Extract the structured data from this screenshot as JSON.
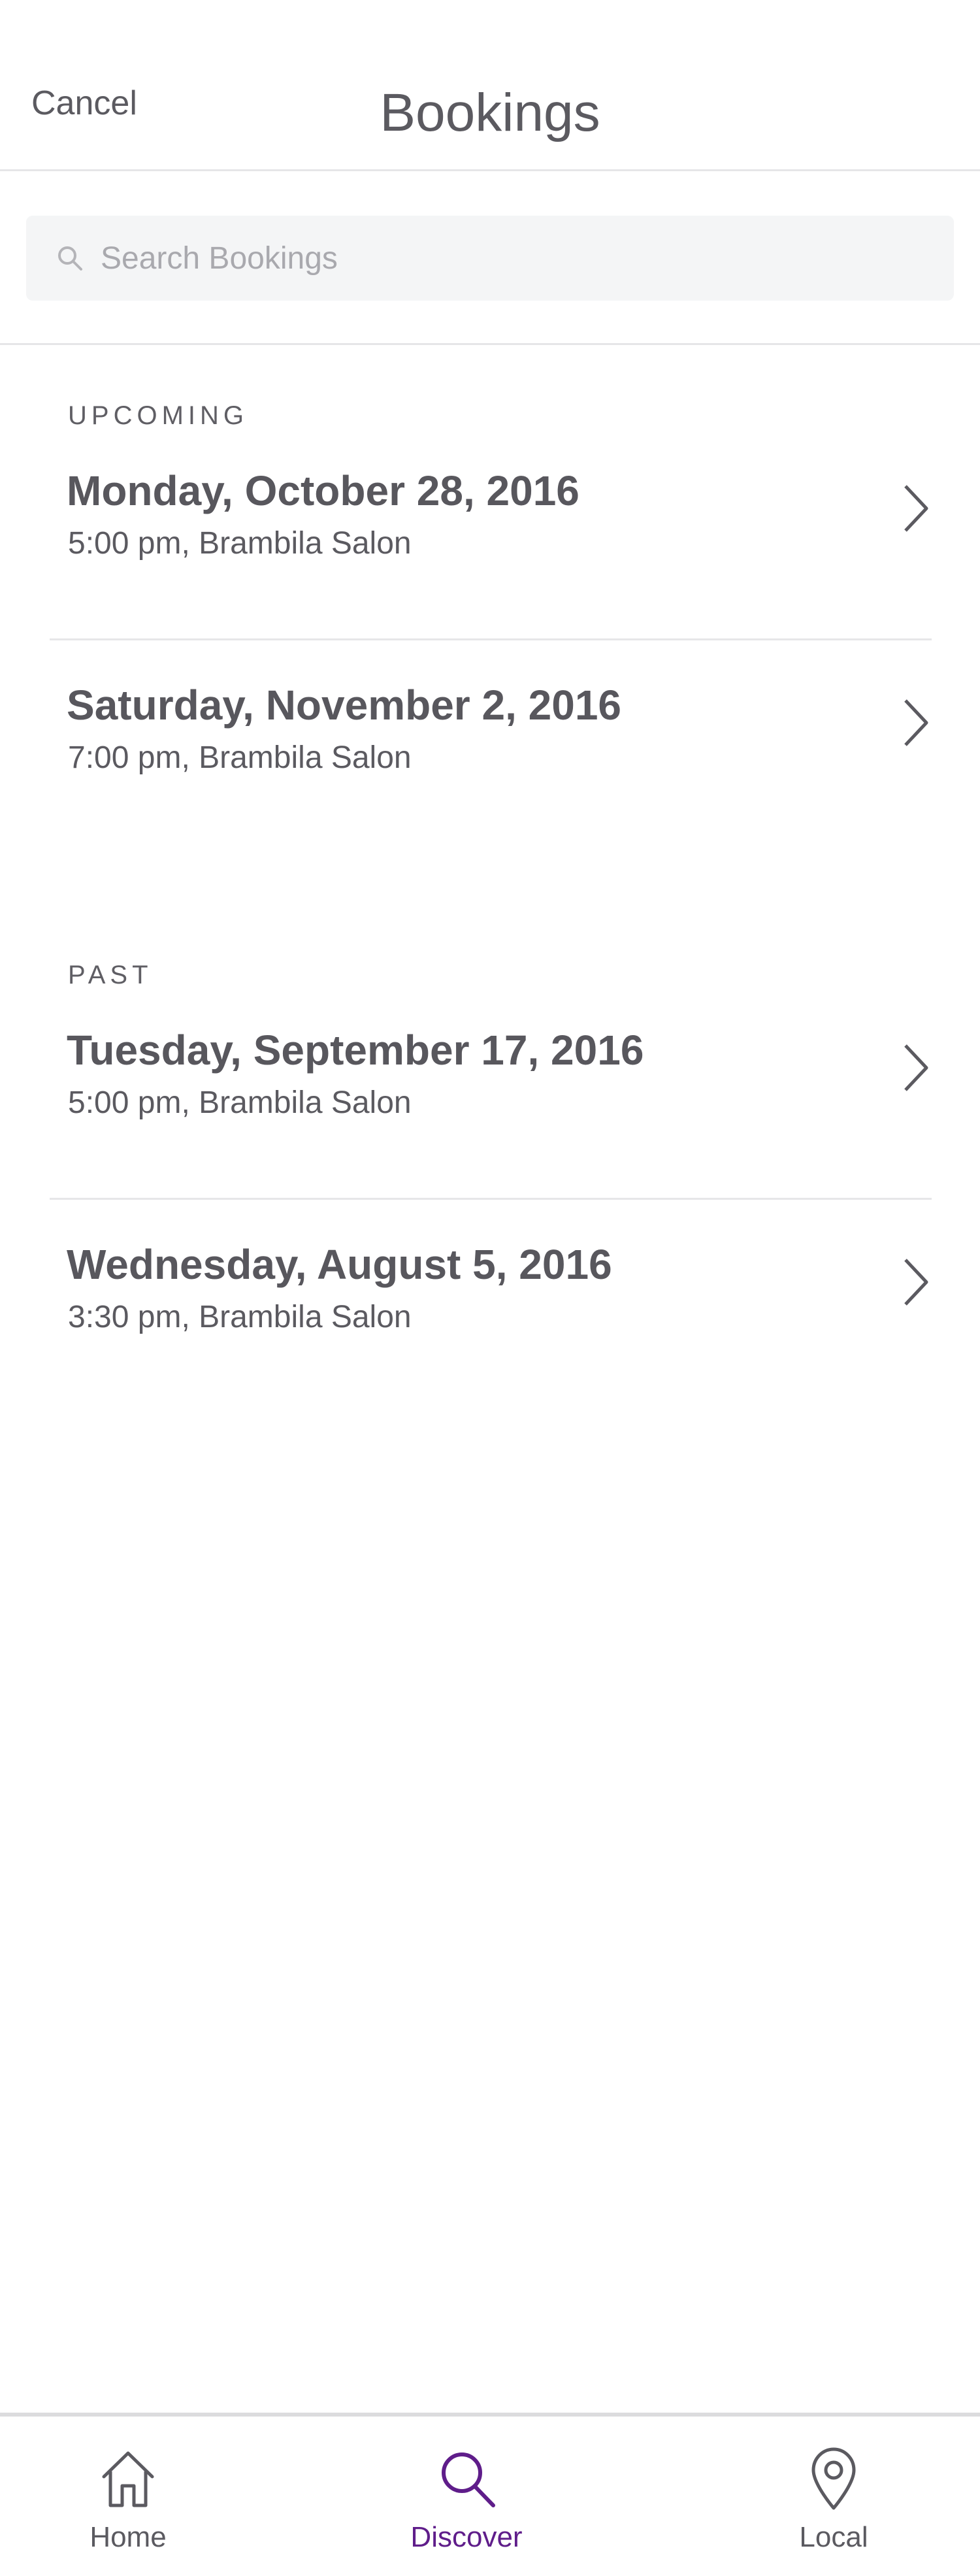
{
  "header": {
    "cancel_label": "Cancel",
    "title": "Bookings"
  },
  "search": {
    "placeholder": "Search Bookings",
    "value": ""
  },
  "sections": {
    "upcoming": {
      "label": "UPCOMING",
      "bookings": [
        {
          "date": "Monday, October 28, 2016",
          "detail": "5:00 pm, Brambila Salon"
        },
        {
          "date": "Saturday, November 2, 2016",
          "detail": "7:00 pm, Brambila Salon"
        }
      ]
    },
    "past": {
      "label": "PAST",
      "bookings": [
        {
          "date": "Tuesday, September 17, 2016",
          "detail": "5:00 pm, Brambila Salon"
        },
        {
          "date": "Wednesday, August 5, 2016",
          "detail": "3:30 pm, Brambila Salon"
        }
      ]
    }
  },
  "tabbar": {
    "tabs": [
      {
        "label": "Home",
        "icon": "home-icon",
        "active": false
      },
      {
        "label": "Discover",
        "icon": "search-icon",
        "active": true
      },
      {
        "label": "Local",
        "icon": "map-pin-icon",
        "active": false
      }
    ]
  },
  "colors": {
    "text": "#58575d",
    "accent": "#5f1d8a",
    "divider": "#e6e6e8",
    "search_bg": "#f4f5f6"
  }
}
